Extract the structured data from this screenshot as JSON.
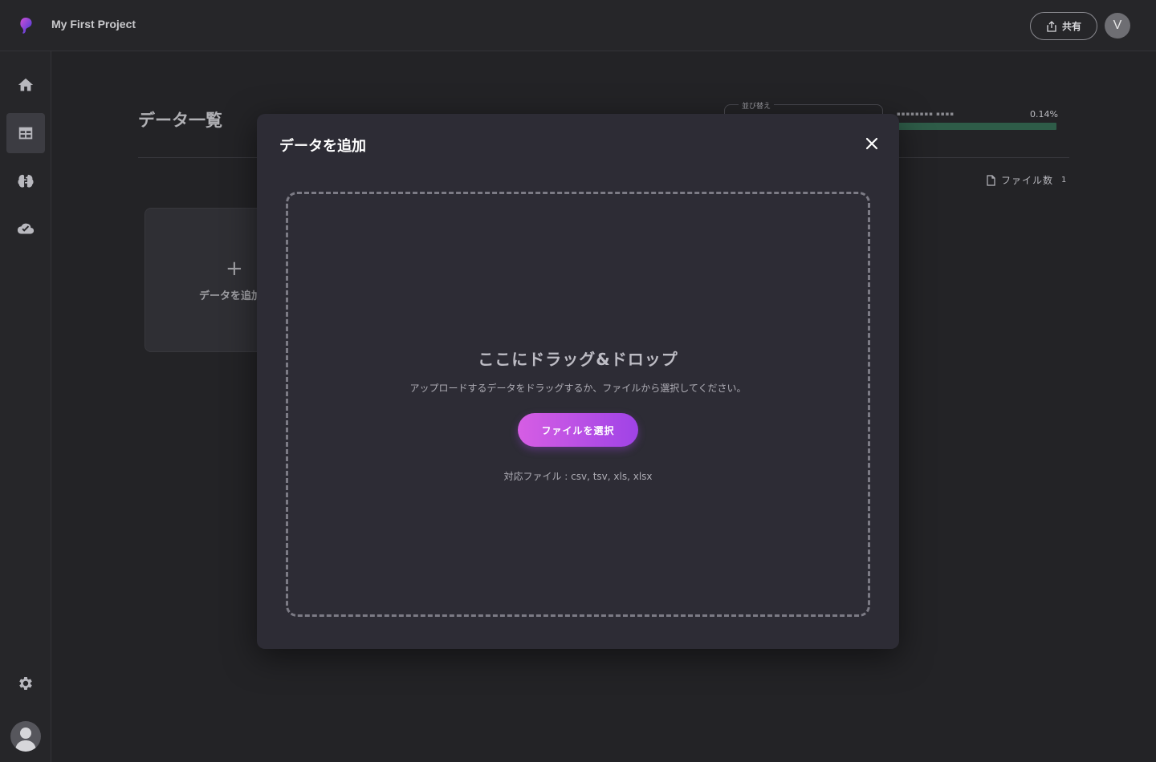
{
  "header": {
    "project_title": "My First Project",
    "share_label": "共有",
    "user_initial": "V"
  },
  "sidebar": {
    "items": [
      {
        "icon": "home-icon",
        "active": false
      },
      {
        "icon": "table-icon",
        "active": true
      },
      {
        "icon": "brain-icon",
        "active": false
      },
      {
        "icon": "cloud-check-icon",
        "active": false
      }
    ],
    "settings_icon": "gear-icon"
  },
  "main": {
    "title": "データ一覧",
    "sort_label": "並び替え",
    "usage_percent": "0.14%",
    "file_count_label": "ファイル数",
    "file_count": "1",
    "add_card_plus": "+",
    "add_card_label": "データを追加"
  },
  "modal": {
    "title": "データを追加",
    "drop_heading": "ここにドラッグ&ドロップ",
    "drop_description": "アップロードするデータをドラッグするか、ファイルから選択してください。",
    "select_button": "ファイルを選択",
    "supported_types": "対応ファイル : csv, tsv, xls, xlsx"
  },
  "colors": {
    "button_gradient_start": "#d65ee4",
    "button_gradient_end": "#9f43e6",
    "usage_bar": "#2e5c48"
  }
}
